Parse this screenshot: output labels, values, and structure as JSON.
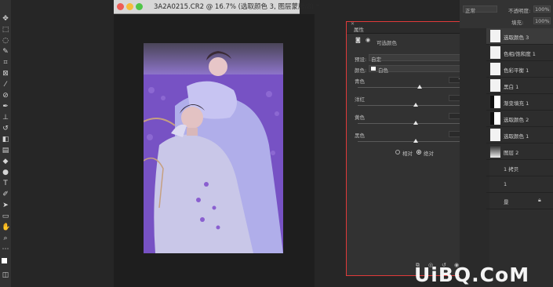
{
  "document": {
    "title": "3A2A0215.CR2 @ 16.7% (选取颜色 3, 图层蒙版/8) *"
  },
  "properties_panel": {
    "header_label": "属性",
    "adjustment_label": "可选颜色",
    "preset_label": "预设:",
    "preset_value": "自定",
    "colors_label": "颜色:",
    "colors_value": "白色",
    "sliders": [
      {
        "name": "青色",
        "value": "+7",
        "pct": "%",
        "level": 0.535
      },
      {
        "name": "洋红",
        "value": "0",
        "pct": "%",
        "level": 0.5
      },
      {
        "name": "黄色",
        "value": "0",
        "pct": "%",
        "level": 0.5
      },
      {
        "name": "黑色",
        "value": "0",
        "pct": "%",
        "level": 0.5
      }
    ],
    "radio_relative": "相对",
    "radio_absolute": "绝对",
    "selected_method": "绝对"
  },
  "top_right": {
    "blend_mode": "正常",
    "opacity_label": "不透明度:",
    "opacity_value": "100%",
    "fill_label": "填充:",
    "fill_value": "100%"
  },
  "layers": [
    {
      "name": "选取颜色 3",
      "thumb": "white"
    },
    {
      "name": "色相/饱和度 1",
      "thumb": "white"
    },
    {
      "name": "色彩平衡 1",
      "thumb": "white"
    },
    {
      "name": "黑白 1",
      "thumb": "white"
    },
    {
      "name": "渐变填充 1",
      "thumb": "mask"
    },
    {
      "name": "选取颜色 2",
      "thumb": "mask"
    },
    {
      "name": "选取颜色 1",
      "thumb": "white"
    },
    {
      "name": "图层 2",
      "thumb": "photo"
    },
    {
      "name": "1 拷贝",
      "thumb": "none"
    },
    {
      "name": "1",
      "thumb": "none"
    },
    {
      "name": "景",
      "thumb": "none"
    }
  ],
  "watermark": "UiBQ.CoM",
  "colors": {
    "highlight_border": "#e03a3a",
    "panel_bg": "#323232"
  }
}
